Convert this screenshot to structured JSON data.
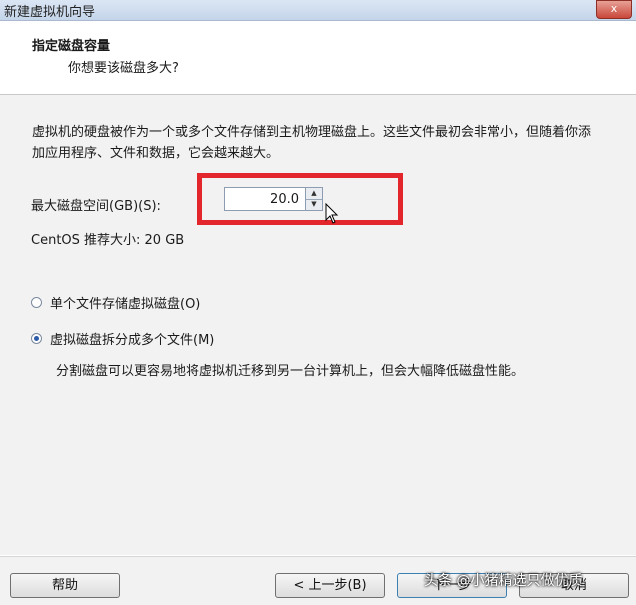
{
  "window": {
    "title": "新建虚拟机向导",
    "close_label": "x"
  },
  "header": {
    "title": "指定磁盘容量",
    "subtitle": "你想要该磁盘多大?"
  },
  "body": {
    "description": "虚拟机的硬盘被作为一个或多个文件存储到主机物理磁盘上。这些文件最初会非常小，但随着你添加应用程序、文件和数据，它会越来越大。",
    "size_label": "最大磁盘空间(GB)(S):",
    "size_value": "20.0",
    "recommend": "CentOS 推荐大小: 20 GB",
    "options": [
      {
        "label": "单个文件存储虚拟磁盘(O)",
        "selected": false
      },
      {
        "label": "虚拟磁盘拆分成多个文件(M)",
        "selected": true
      }
    ],
    "split_desc": "分割磁盘可以更容易地将虚拟机迁移到另一台计算机上，但会大幅降低磁盘性能。"
  },
  "footer": {
    "help": "帮助",
    "back": "< 上一步(B)",
    "next": "下一步",
    "cancel": "取消"
  },
  "watermark": "头条 @小猪精选只做优质",
  "colors": {
    "highlight": "#e3262b",
    "radio_fill": "#2b5aa8"
  },
  "icons": {
    "spinner_up": "▲",
    "spinner_down": "▼"
  }
}
